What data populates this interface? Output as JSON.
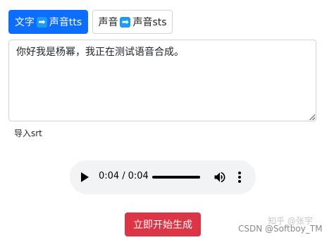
{
  "tabs": [
    {
      "left": "文字",
      "arrow": "➡",
      "right": "声音tts",
      "active": true
    },
    {
      "left": "声音",
      "arrow": "➡",
      "right": "声音sts",
      "active": false
    }
  ],
  "textarea": {
    "value": "你好我是杨幂，我正在测试语音合成。"
  },
  "import_label": "导入srt",
  "audio": {
    "current_time": "0:04",
    "separator": "/",
    "duration": "0:04",
    "progress": 1.0,
    "icons": [
      "play-icon",
      "volume-icon",
      "more-vertical-icon"
    ]
  },
  "start_button": "立即开始生成",
  "colors": {
    "primary": "#0d6efd",
    "danger": "#dc3545",
    "arrow_box": "#1d9bf0",
    "player_bg": "#f1f3f4"
  },
  "watermark": {
    "top": "知乎 @张宇",
    "bottom": "CSDN @Softboy_TM"
  }
}
